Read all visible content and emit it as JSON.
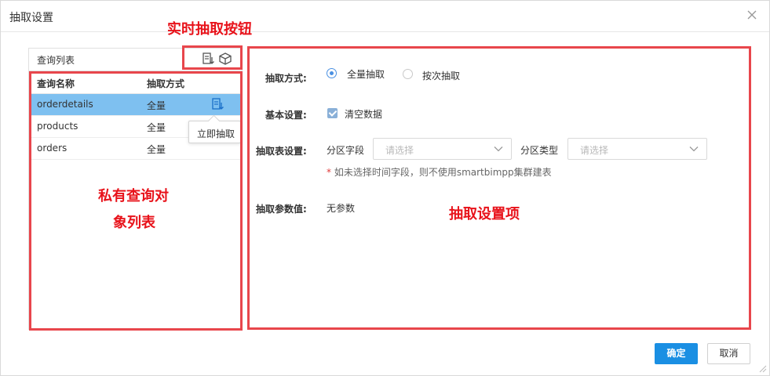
{
  "dialog": {
    "title": "抽取设置",
    "close_icon": "close-icon"
  },
  "query_list": {
    "title": "查询列表",
    "tool_icons": [
      "extract-now-icon",
      "cube-icon"
    ],
    "columns": [
      "查询名称",
      "抽取方式"
    ],
    "rows": [
      {
        "name": "orderdetails",
        "mode": "全量",
        "selected": true
      },
      {
        "name": "products",
        "mode": "全量",
        "selected": false
      },
      {
        "name": "orders",
        "mode": "全量",
        "selected": false
      }
    ],
    "tooltip": "立即抽取"
  },
  "settings": {
    "mode_label": "抽取方式:",
    "mode_options": [
      {
        "label": "全量抽取",
        "checked": true
      },
      {
        "label": "按次抽取",
        "checked": false
      }
    ],
    "basic_label": "基本设置:",
    "clear_data_label": "清空数据",
    "clear_data_checked": true,
    "table_label": "抽取表设置:",
    "partition_field_label": "分区字段",
    "partition_field_placeholder": "请选择",
    "partition_type_label": "分区类型",
    "partition_type_placeholder": "请选择",
    "hint_star": "*",
    "hint_text": " 如未选择时间字段，则不使用smartbimpp集群建表",
    "params_label": "抽取参数值:",
    "params_value": "无参数"
  },
  "footer": {
    "ok_label": "确定",
    "cancel_label": "取消"
  },
  "annotations": {
    "realtime_button": "实时抽取按钮",
    "private_list_line1": "私有查询对",
    "private_list_line2": "象列表",
    "settings_items": "抽取设置项",
    "color": "#e8464c"
  },
  "colors": {
    "primary": "#1a8fe3",
    "selected_row": "#7ec0f0",
    "checkbox": "#8ab0d8"
  }
}
